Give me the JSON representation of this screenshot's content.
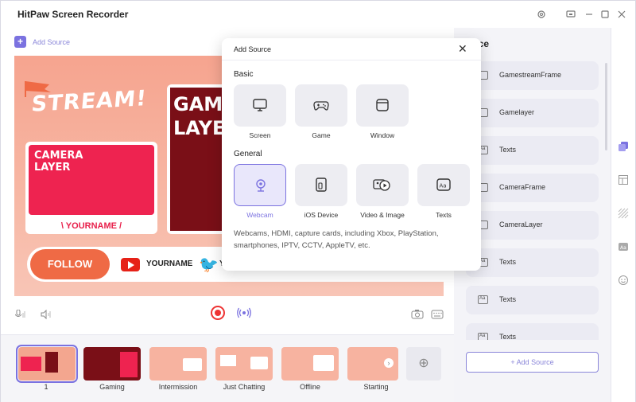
{
  "app": {
    "title": "HitPaw Screen Recorder"
  },
  "toolbar": {
    "add_source_label": "Add Source"
  },
  "preview": {
    "stream_text": "STREAM!",
    "camera_layer_text": "CAMERA\nLAYER",
    "yourname_text": "\\ YOURNAME /",
    "game_layer_text": "GAME\nLAYER",
    "follow_text": "FOLLOW",
    "yt_name": "YOURNAME",
    "tw_name": "Y"
  },
  "scenes": [
    {
      "label": "1"
    },
    {
      "label": "Gaming"
    },
    {
      "label": "Intermission"
    },
    {
      "label": "Just Chatting"
    },
    {
      "label": "Offline"
    },
    {
      "label": "Starting"
    }
  ],
  "right_panel": {
    "title": "rce",
    "sources": [
      {
        "label": "GamestreamFrame",
        "icon": "image-icon"
      },
      {
        "label": "Gamelayer",
        "icon": "image-icon"
      },
      {
        "label": "Texts",
        "icon": "text-icon"
      },
      {
        "label": "CameraFrame",
        "icon": "image-icon"
      },
      {
        "label": "CameraLayer",
        "icon": "image-icon"
      },
      {
        "label": "Texts",
        "icon": "text-icon"
      },
      {
        "label": "Texts",
        "icon": "text-icon"
      },
      {
        "label": "Texts",
        "icon": "text-icon"
      }
    ],
    "add_source_button": "+ Add Source"
  },
  "popup": {
    "title": "Add Source",
    "basic_label": "Basic",
    "basic_items": [
      {
        "label": "Screen",
        "icon": "monitor-icon"
      },
      {
        "label": "Game",
        "icon": "gamepad-icon"
      },
      {
        "label": "Window",
        "icon": "window-icon"
      }
    ],
    "general_label": "General",
    "general_items": [
      {
        "label": "Webcam",
        "icon": "webcam-icon",
        "selected": true
      },
      {
        "label": "iOS Device",
        "icon": "ios-device-icon"
      },
      {
        "label": "Video & Image",
        "icon": "video-image-icon"
      },
      {
        "label": "Texts",
        "icon": "text-icon"
      }
    ],
    "description": "Webcams, HDMI, capture cards, including Xbox, PlayStation, smartphones, IPTV, CCTV, AppleTV, etc."
  },
  "colors": {
    "accent": "#7b72e0",
    "record": "#e33333"
  }
}
